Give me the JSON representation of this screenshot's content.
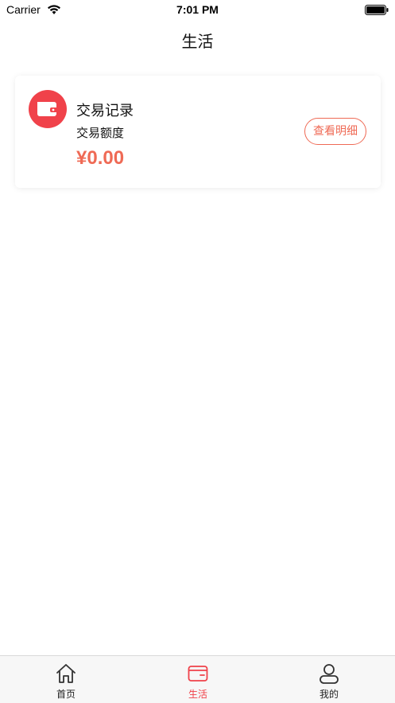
{
  "status_bar": {
    "carrier": "Carrier",
    "time": "7:01 PM"
  },
  "nav": {
    "title": "生活"
  },
  "card": {
    "title": "交易记录",
    "subtitle": "交易额度",
    "amount": "¥0.00",
    "detail_button": "查看明细",
    "icon": "wallet-icon",
    "accent_color": "#f0424a",
    "amount_color": "#ef6a55"
  },
  "tab_bar": {
    "active": "life",
    "items": [
      {
        "id": "home",
        "label": "首页",
        "icon": "home-icon"
      },
      {
        "id": "life",
        "label": "生活",
        "icon": "card-icon"
      },
      {
        "id": "mine",
        "label": "我的",
        "icon": "user-icon"
      }
    ]
  }
}
